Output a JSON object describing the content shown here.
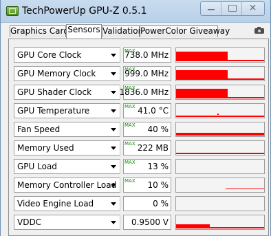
{
  "window": {
    "title": "TechPowerUp GPU-Z 0.5.1",
    "minimize": "",
    "maximize": "",
    "close": "✕"
  },
  "tabs": [
    {
      "label": "Graphics Card",
      "active": false
    },
    {
      "label": "Sensors",
      "active": true
    },
    {
      "label": "Validation",
      "active": false
    },
    {
      "label": "PowerColor Giveaway",
      "active": false
    }
  ],
  "sensors": [
    {
      "label": "GPU Core Clock",
      "show_max": true,
      "value": "738.0 MHz",
      "level": 0.58
    },
    {
      "label": "GPU Memory Clock",
      "show_max": true,
      "value": "999.0 MHz",
      "level": 0.58
    },
    {
      "label": "GPU Shader Clock",
      "show_max": true,
      "value": "1836.0 MHz",
      "level": 0.58
    },
    {
      "label": "GPU Temperature",
      "show_max": true,
      "value": "41.0 °C",
      "level": 0.12
    },
    {
      "label": "Fan Speed",
      "show_max": true,
      "value": "40 %",
      "level": 0.15
    },
    {
      "label": "Memory Used",
      "show_max": true,
      "value": "222 MB",
      "level": 0.1
    },
    {
      "label": "GPU Load",
      "show_max": true,
      "value": "13 %",
      "level": 0
    },
    {
      "label": "Memory Controller Load",
      "show_max": true,
      "value": "10 %",
      "level": 0.04
    },
    {
      "label": "Video Engine Load",
      "show_max": false,
      "value": "0 %",
      "level": 0
    },
    {
      "label": "VDDC",
      "show_max": false,
      "value": "0.9500 V",
      "level": 0.38
    }
  ],
  "max_text": "MAX",
  "colors": {
    "graph": "#ff0000",
    "max": "#0d8a00",
    "title_bar": "#c9dcef"
  },
  "icons": {
    "app": "gpu-z-icon",
    "camera": "camera-icon",
    "dropdown": "chevron-down-icon"
  }
}
